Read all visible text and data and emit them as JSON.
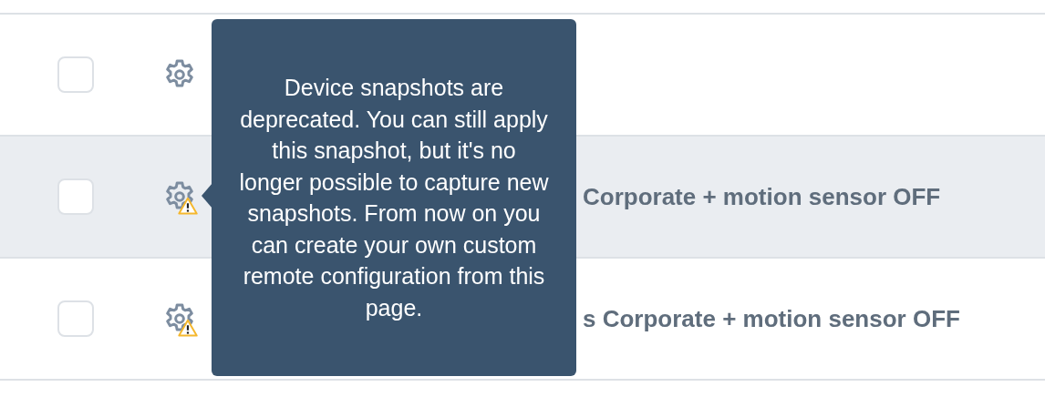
{
  "rows": [
    {
      "checked": false,
      "highlighted": false,
      "deprecated": false
    },
    {
      "checked": false,
      "highlighted": true,
      "deprecated": true,
      "name": "Corporate + motion sensor OFF"
    },
    {
      "checked": false,
      "highlighted": false,
      "deprecated": true,
      "name": "s Corporate + motion sensor OFF"
    }
  ],
  "tooltip": {
    "text": "Device snapshots are deprecated. You can still apply this snapshot, but it's no longer possible to capture new snapshots. From now on you can create your own custom remote configuration from this page."
  }
}
